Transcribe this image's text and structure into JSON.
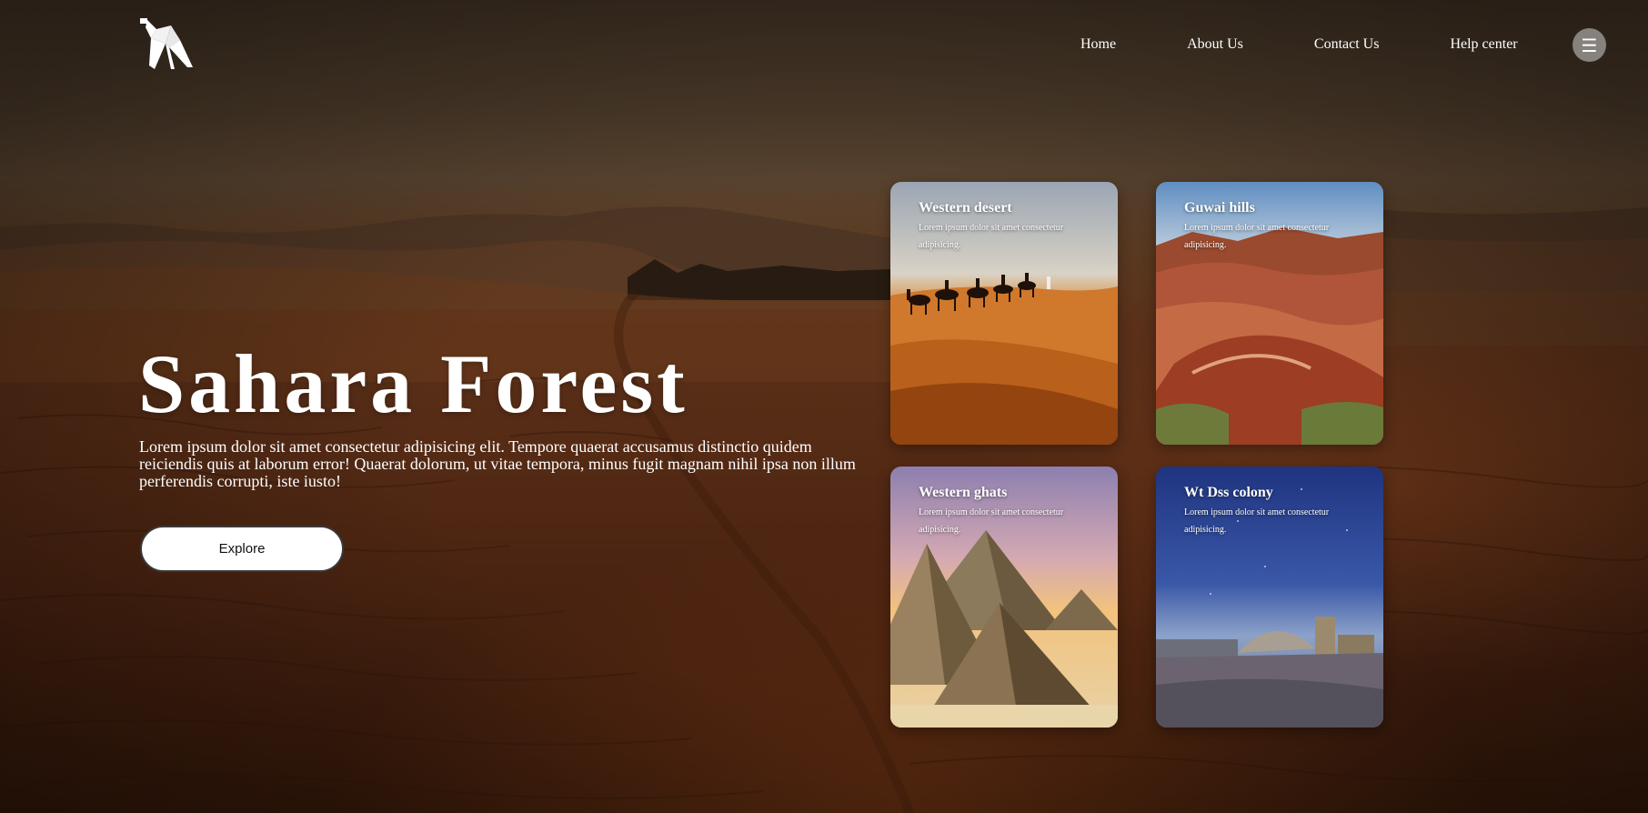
{
  "nav": {
    "items": [
      {
        "label": "Home"
      },
      {
        "label": "About Us"
      },
      {
        "label": "Contact Us"
      },
      {
        "label": "Help center"
      }
    ],
    "menu_icon": "☰"
  },
  "hero": {
    "title": "Sahara Forest",
    "description": "Lorem ipsum dolor sit amet consectetur adipisicing elit. Tempore quaerat accusamus distinctio quidem reiciendis quis at laborum error! Quaerat dolorum, ut vitae tempora, minus fugit magnam nihil ipsa non illum perferendis corrupti, iste iusto!",
    "button_label": "Explore"
  },
  "cards": [
    {
      "title": "Western desert",
      "description": "Lorem ipsum dolor sit amet consectetur adipisicing."
    },
    {
      "title": "Guwai hills",
      "description": "Lorem ipsum dolor sit amet consectetur adipisicing."
    },
    {
      "title": "Western ghats",
      "description": "Lorem ipsum dolor sit amet consectetur adipisicing."
    },
    {
      "title": "Wt Dss colony",
      "description": "Lorem ipsum dolor sit amet consectetur adipisicing."
    }
  ],
  "colors": {
    "background": "#4b2a16",
    "button_bg": "#ffffff",
    "menu_button": "#a8a8a8"
  }
}
